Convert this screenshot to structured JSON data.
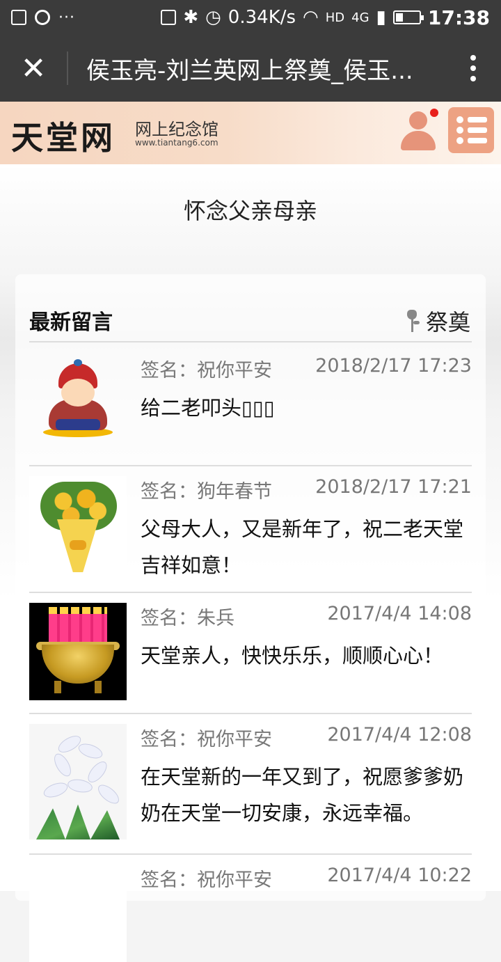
{
  "status_bar": {
    "speed": "0.34K/s",
    "network": "HD",
    "signal_label": "4G",
    "time": "17:38"
  },
  "title_bar": {
    "title": "侯玉亮-刘兰英网上祭奠_侯玉..."
  },
  "banner": {
    "logo": "天堂网",
    "subtitle": "网上纪念馆",
    "url": "www.tiantang6.com"
  },
  "page_title": "怀念父亲母亲",
  "section": {
    "heading": "最新留言",
    "offer_label": "祭奠"
  },
  "messages": [
    {
      "sign": "签名：祝你平安",
      "date": "2018/2/17 17:23",
      "text": "给二老叩头▯▯▯",
      "avatar": "monk-cartoon"
    },
    {
      "sign": "签名：狗年春节",
      "date": "2018/2/17 17:21",
      "text": "父母大人，又是新年了，祝二老天堂吉祥如意！",
      "avatar": "flower-bouquet"
    },
    {
      "sign": "签名：朱兵",
      "date": "2017/4/4 14:08",
      "text": "天堂亲人，快快乐乐，顺顺心心！",
      "avatar": "incense-burner"
    },
    {
      "sign": "签名：祝你平安",
      "date": "2017/4/4 12:08",
      "text": "在天堂新的一年又到了，祝愿爹爹奶奶在天堂一切安康，永远幸福。",
      "avatar": "white-lily"
    },
    {
      "sign": "签名：祝你平安",
      "date": "2017/4/4 10:22",
      "text": "",
      "avatar": "partial"
    }
  ]
}
